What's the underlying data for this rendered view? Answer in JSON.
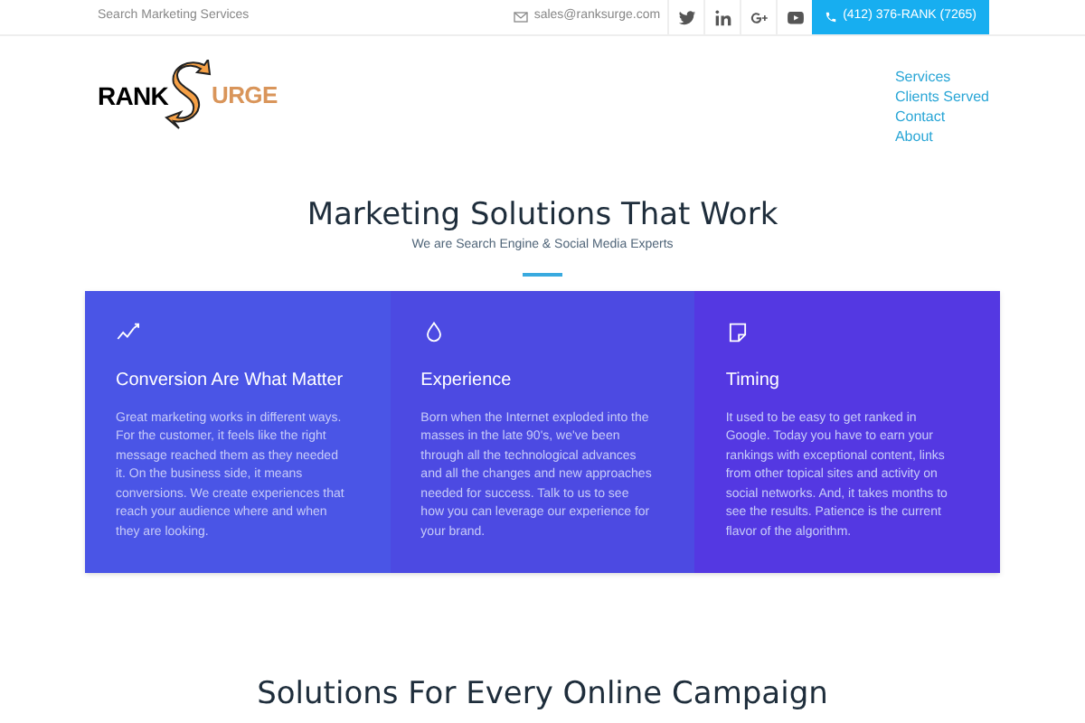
{
  "topbar": {
    "tagline": "Search Marketing Services",
    "email": "sales@ranksurge.com",
    "socials": [
      {
        "kind": "twitter"
      },
      {
        "kind": "linkedin"
      },
      {
        "kind": "googleplus"
      },
      {
        "kind": "youtube"
      }
    ],
    "phone": "(412) 376-RANK (7265)"
  },
  "logo": {
    "left": "RANK",
    "right": "URGE"
  },
  "nav": [
    "Services",
    "Clients Served",
    "Contact",
    "About"
  ],
  "hero": {
    "title": "Marketing Solutions That Work",
    "subtitle": "We are Search Engine & Social Media Experts"
  },
  "features": [
    {
      "kind": "trend",
      "title": "Conversion Are What Matter",
      "body": "Great marketing works in different ways. For the customer, it feels like the right message reached them as they needed it. On the business side, it means conversions. We create experiences that reach your audience where and when they are looking."
    },
    {
      "kind": "drop",
      "title": "Experience",
      "body": "Born when the Internet exploded into the masses in the late 90's, we've been through all the technological advances and all the changes and new approaches needed for success. Talk to us to see how you can leverage our experience for your brand."
    },
    {
      "kind": "note",
      "title": "Timing",
      "body": "It used to be easy to get ranked in Google. Today you have to earn your rankings with exceptional content, links from other topical sites and activity on social networks. And, it takes months to see the results. Patience is the current flavor of the algorithm."
    }
  ],
  "next_section": {
    "title": "Solutions For Every Online Campaign"
  }
}
